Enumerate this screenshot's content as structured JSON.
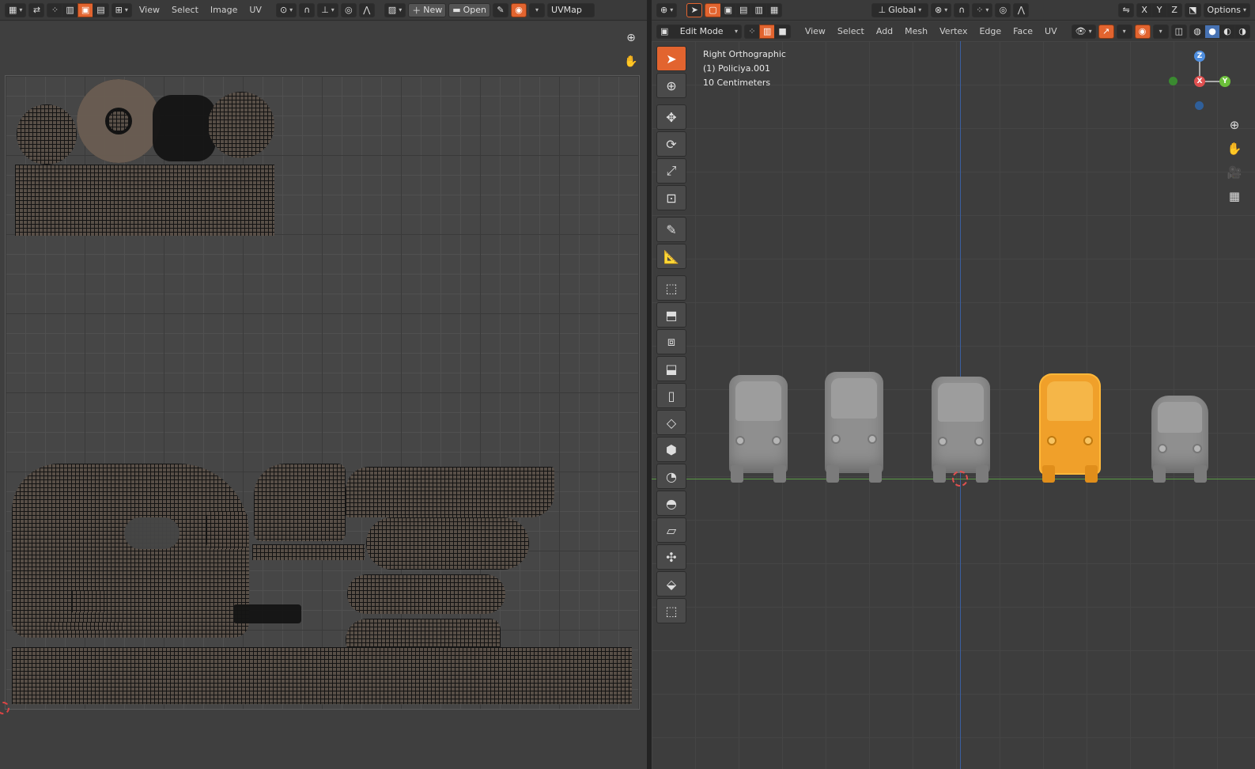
{
  "uv_editor": {
    "menus": [
      "View",
      "Select",
      "Image",
      "UV"
    ],
    "new_label": "New",
    "open_label": "Open",
    "uvmap_field": "UVMap"
  },
  "viewport": {
    "transform_orientation": "Global",
    "axis_labels": [
      "X",
      "Y",
      "Z"
    ],
    "options_label": "Options",
    "mode_label": "Edit Mode",
    "menus": [
      "View",
      "Select",
      "Add",
      "Mesh",
      "Vertex",
      "Edge",
      "Face",
      "UV"
    ],
    "overlay": {
      "view_name": "Right Orthographic",
      "object_name": "(1) Policiya.001",
      "scale": "10 Centimeters"
    },
    "gizmo": {
      "x": "X",
      "y": "Y",
      "z": "Z"
    }
  },
  "colors": {
    "accent": "#e2642f",
    "selection": "#f0a02a",
    "x_axis": "#e05050",
    "y_axis": "#6bbf3a",
    "z_axis": "#4f8fe0"
  }
}
